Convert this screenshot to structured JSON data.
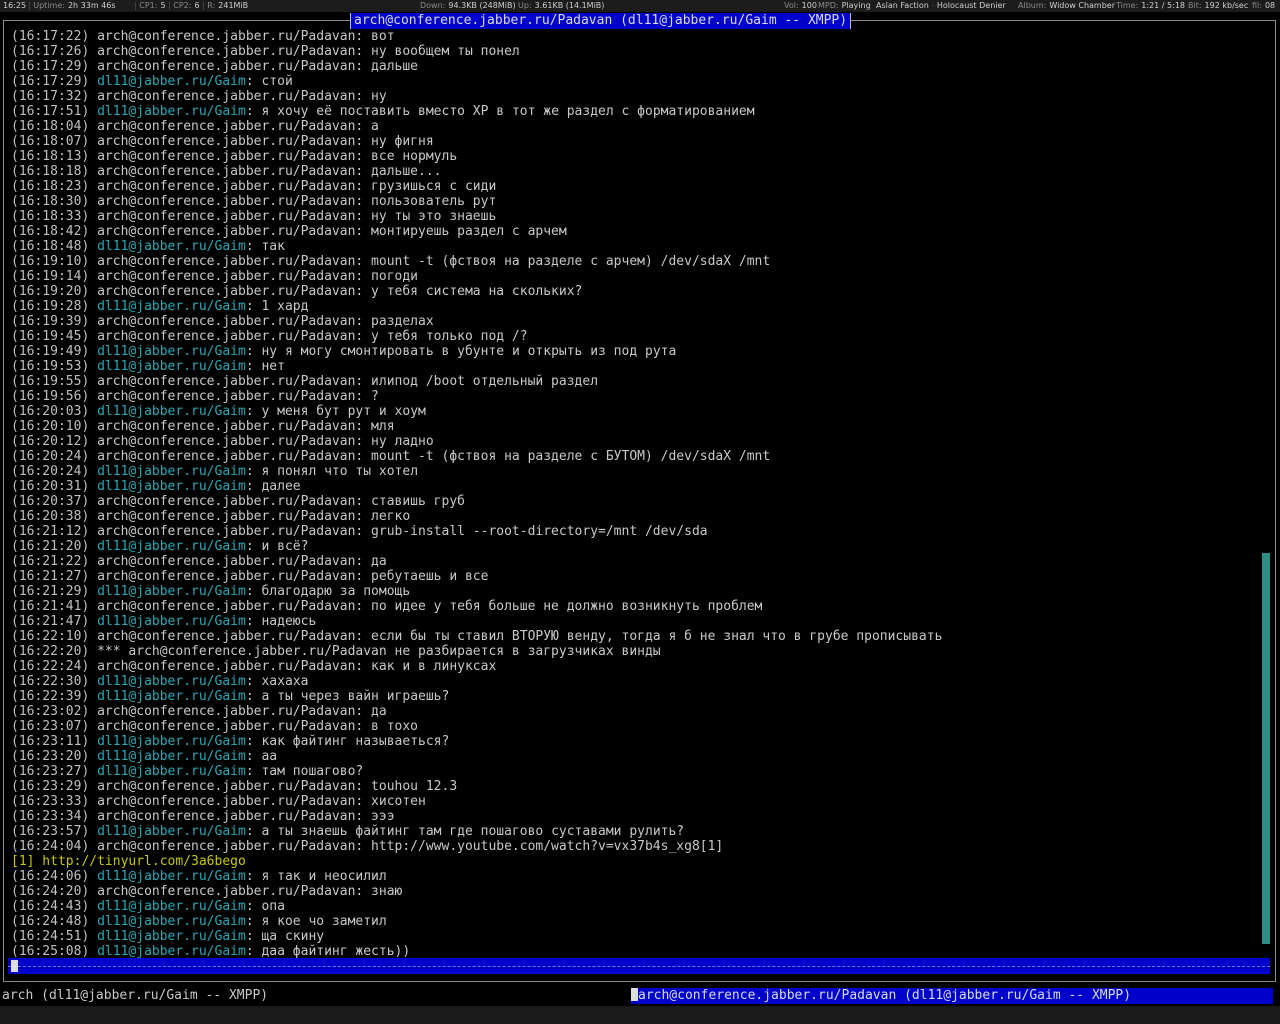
{
  "topbar": {
    "clock": "16:25",
    "uptime_label": "Uptime:",
    "uptime": "2h 33m 46s",
    "cpu1_label": "CP1:",
    "cpu1": "5",
    "cpu2_label": "CP2:",
    "cpu2": "6",
    "ram_label": "R:",
    "ram": "241MiB",
    "down_label": "Down:",
    "down": "94.3KB (248MiB)",
    "up_label": "Up:",
    "up": "3.61KB (14.1MiB)",
    "vol_label": "Vol:",
    "vol": "100",
    "mpd_label": "MPD:",
    "mpd_state": "Playing",
    "artist": "Aslan Faction",
    "dash": "-",
    "track": "Holocaust Denier",
    "album_label": "Album:",
    "album": "Widow Chamber",
    "time_label": "Time:",
    "time": "1:21 / 5:18",
    "bit_label": "Bit:",
    "bit": "192 kb/sec",
    "extra_label": "fil:",
    "extra": "08"
  },
  "window_title": "arch@conference.jabber.ru/Padavan (dl11@jabber.ru/Gaim -- XMPP)",
  "nick_arch": "arch@conference.jabber.ru/Padavan",
  "nick_dl": "dl11@jabber.ru/Gaim",
  "messages": [
    {
      "time": "(16:17:22)",
      "who": "arch",
      "text": "вот"
    },
    {
      "time": "(16:17:26)",
      "who": "arch",
      "text": "ну вообщем ты понел"
    },
    {
      "time": "(16:17:29)",
      "who": "arch",
      "text": "дальше"
    },
    {
      "time": "(16:17:29)",
      "who": "dl",
      "text": "стой"
    },
    {
      "time": "(16:17:32)",
      "who": "arch",
      "text": "ну"
    },
    {
      "time": "(16:17:51)",
      "who": "dl",
      "text": "я хочу её поставить вместо XP в тот же раздел с форматированием"
    },
    {
      "time": "(16:18:04)",
      "who": "arch",
      "text": "а"
    },
    {
      "time": "(16:18:07)",
      "who": "arch",
      "text": "ну фигня"
    },
    {
      "time": "(16:18:13)",
      "who": "arch",
      "text": "все нормуль"
    },
    {
      "time": "(16:18:18)",
      "who": "arch",
      "text": "дальше..."
    },
    {
      "time": "(16:18:23)",
      "who": "arch",
      "text": "грузишься с сиди"
    },
    {
      "time": "(16:18:30)",
      "who": "arch",
      "text": "пользователь рут"
    },
    {
      "time": "(16:18:33)",
      "who": "arch",
      "text": "ну ты это знаешь"
    },
    {
      "time": "(16:18:42)",
      "who": "arch",
      "text": "монтируешь раздел с арчем"
    },
    {
      "time": "(16:18:48)",
      "who": "dl",
      "text": "так"
    },
    {
      "time": "(16:19:10)",
      "who": "arch",
      "text": "mount -t (фствоя на разделе с арчем) /dev/sdaX /mnt"
    },
    {
      "time": "(16:19:14)",
      "who": "arch",
      "text": "погоди"
    },
    {
      "time": "(16:19:20)",
      "who": "arch",
      "text": "у тебя система на скольких?"
    },
    {
      "time": "(16:19:28)",
      "who": "dl",
      "text": "1 хард"
    },
    {
      "time": "(16:19:39)",
      "who": "arch",
      "text": "разделах"
    },
    {
      "time": "(16:19:45)",
      "who": "arch",
      "text": "у тебя только под /?"
    },
    {
      "time": "(16:19:49)",
      "who": "dl",
      "text": "ну я могу смонтировать в убунте и открыть из под рута"
    },
    {
      "time": "(16:19:53)",
      "who": "dl",
      "text": "нет"
    },
    {
      "time": "(16:19:55)",
      "who": "arch",
      "text": "илипод /boot отдельный раздел"
    },
    {
      "time": "(16:19:56)",
      "who": "arch",
      "text": "?"
    },
    {
      "time": "(16:20:03)",
      "who": "dl",
      "text": "у меня бут рут и хоум"
    },
    {
      "time": "(16:20:10)",
      "who": "arch",
      "text": "мля"
    },
    {
      "time": "(16:20:12)",
      "who": "arch",
      "text": "ну ладно"
    },
    {
      "time": "(16:20:24)",
      "who": "arch",
      "text": "mount -t (фствоя на разделе с БУТОМ) /dev/sdaX /mnt"
    },
    {
      "time": "(16:20:24)",
      "who": "dl",
      "text": "я понял что ты хотел"
    },
    {
      "time": "(16:20:31)",
      "who": "dl",
      "text": "далее"
    },
    {
      "time": "(16:20:37)",
      "who": "arch",
      "text": "ставишь груб"
    },
    {
      "time": "(16:20:38)",
      "who": "arch",
      "text": "легко"
    },
    {
      "time": "(16:21:12)",
      "who": "arch",
      "text": "grub-install --root-directory=/mnt /dev/sda"
    },
    {
      "time": "(16:21:20)",
      "who": "dl",
      "text": "и всё?"
    },
    {
      "time": "(16:21:22)",
      "who": "arch",
      "text": "да"
    },
    {
      "time": "(16:21:27)",
      "who": "arch",
      "text": "ребутаешь и все"
    },
    {
      "time": "(16:21:29)",
      "who": "dl",
      "text": "благодарю за помощь"
    },
    {
      "time": "(16:21:41)",
      "who": "arch",
      "text": "по идее у тебя больше не должно возникнуть проблем"
    },
    {
      "time": "(16:21:47)",
      "who": "dl",
      "text": "надеюсь"
    },
    {
      "time": "(16:22:10)",
      "who": "arch",
      "text": "если бы ты ставил ВТОРУЮ венду, тогда я б не знал что в грубе прописывать"
    },
    {
      "time": "(16:22:20)",
      "who": "action",
      "text": "*** arch@conference.jabber.ru/Padavan не разбирается в загрузчиках винды"
    },
    {
      "time": "(16:22:24)",
      "who": "arch",
      "text": "как и в линуксах"
    },
    {
      "time": "(16:22:30)",
      "who": "dl",
      "text": "хахаха"
    },
    {
      "time": "(16:22:39)",
      "who": "dl",
      "text": "а ты через вайн играешь?"
    },
    {
      "time": "(16:23:02)",
      "who": "arch",
      "text": "да"
    },
    {
      "time": "(16:23:07)",
      "who": "arch",
      "text": "в тохо"
    },
    {
      "time": "(16:23:11)",
      "who": "dl",
      "text": "как файтинг называеться?"
    },
    {
      "time": "(16:23:20)",
      "who": "dl",
      "text": "аа"
    },
    {
      "time": "(16:23:27)",
      "who": "dl",
      "text": "там пошагово?"
    },
    {
      "time": "(16:23:29)",
      "who": "arch",
      "text": "touhou 12.3"
    },
    {
      "time": "(16:23:33)",
      "who": "arch",
      "text": "хисотен"
    },
    {
      "time": "(16:23:34)",
      "who": "arch",
      "text": "эээ"
    },
    {
      "time": "(16:23:57)",
      "who": "dl",
      "text": "а ты знаешь файтинг там где пошагово суставами рулить?"
    },
    {
      "time": "(16:24:04)",
      "who": "arch",
      "text": "http://www.youtube.com/watch?v=vx37b4s_xg8[1]"
    },
    {
      "time": "",
      "who": "link",
      "text": "[1] http://tinyurl.com/3a6bego"
    },
    {
      "time": "(16:24:06)",
      "who": "dl",
      "text": "я так и неосилил"
    },
    {
      "time": "(16:24:20)",
      "who": "arch",
      "text": "знаю"
    },
    {
      "time": "(16:24:43)",
      "who": "dl",
      "text": "опа"
    },
    {
      "time": "(16:24:48)",
      "who": "dl",
      "text": "я кое чо заметил"
    },
    {
      "time": "(16:24:51)",
      "who": "dl",
      "text": "ща скину"
    },
    {
      "time": "(16:25:08)",
      "who": "dl",
      "text": "даа файтинг жесть))"
    }
  ],
  "status_left": "arch (dl11@jabber.ru/Gaim -- XMPP)",
  "status_tab": "arch@conference.jabber.ru/Padavan (dl11@jabber.ru/Gaim -- XMPP)"
}
